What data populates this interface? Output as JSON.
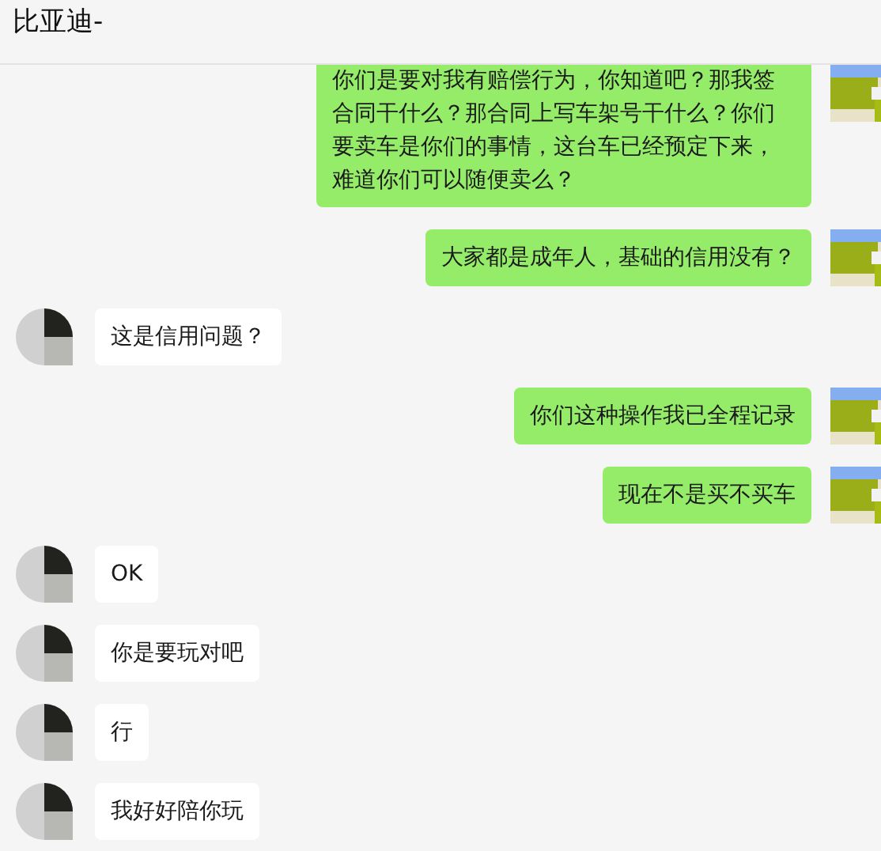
{
  "header": {
    "title": "比亚迪-"
  },
  "messages": [
    {
      "kind": "sent",
      "text": "你们是要对我有赔偿行为，你知道吧？那我签合同干什么？那合同上写车架号干什么？你们要卖车是你们的事情，这台车已经预定下来，难道你们可以随便卖么？"
    },
    {
      "kind": "sent",
      "text": "大家都是成年人，基础的信用没有？"
    },
    {
      "kind": "received",
      "text": "这是信用问题？"
    },
    {
      "kind": "sent",
      "text": "你们这种操作我已全程记录"
    },
    {
      "kind": "sent",
      "text": "现在不是买不买车"
    },
    {
      "kind": "received",
      "text": "OK"
    },
    {
      "kind": "received",
      "text": "你是要玩对吧"
    },
    {
      "kind": "received",
      "text": "行"
    },
    {
      "kind": "received",
      "text": "我好好陪你玩"
    }
  ]
}
